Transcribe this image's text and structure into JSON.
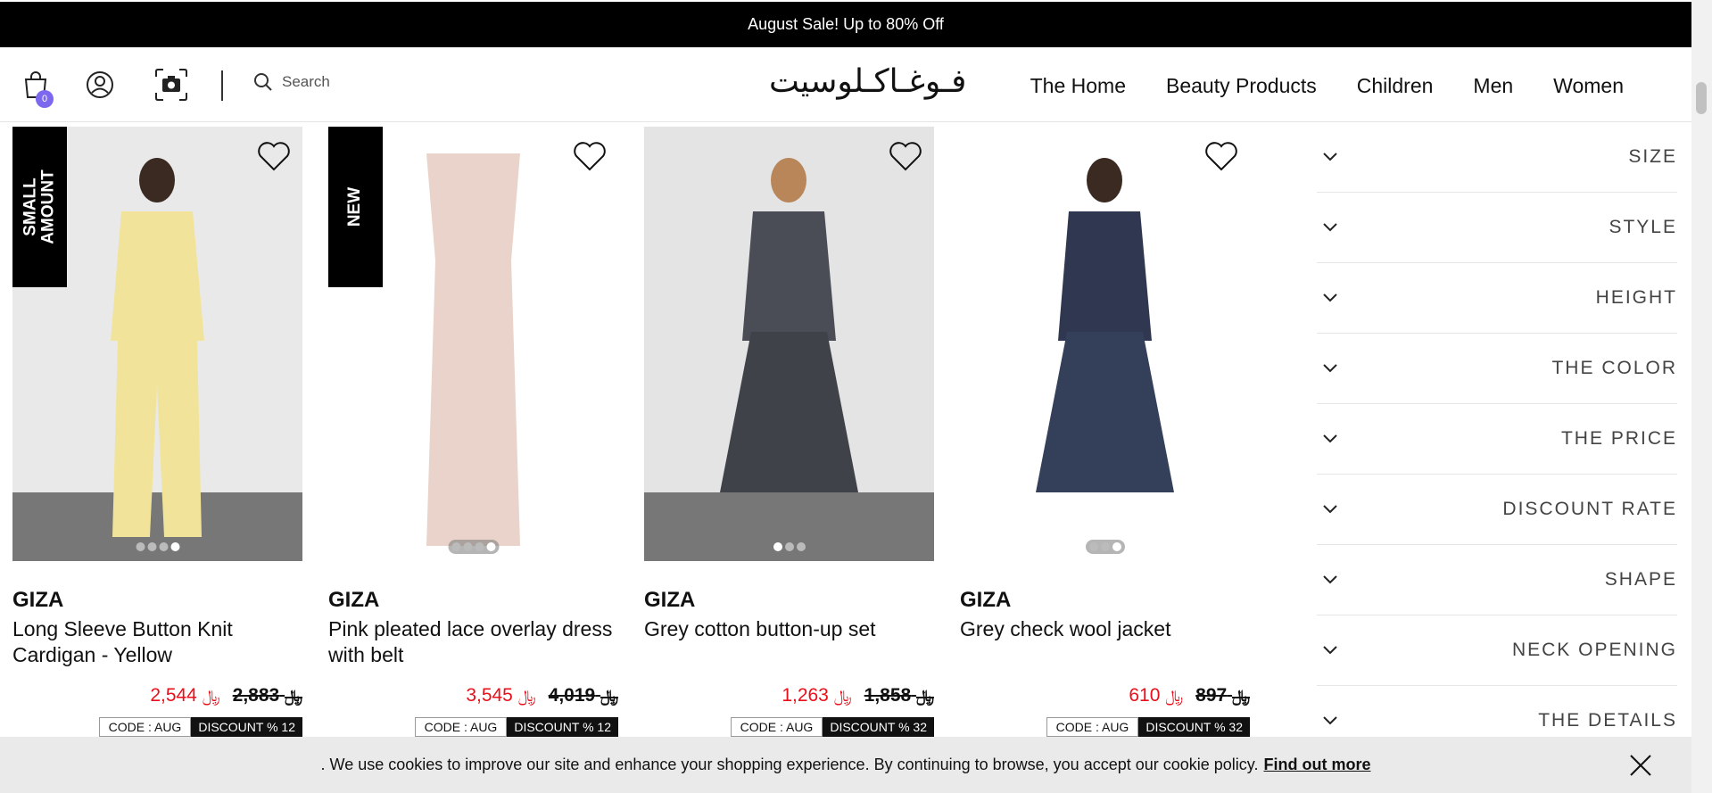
{
  "promo": {
    "text": "August Sale! Up to 80% Off"
  },
  "header": {
    "cart_count": "0",
    "search_placeholder": "Search",
    "logo_text": "فـوغـاكـلوسيت",
    "nav": [
      "The Home",
      "Beauty Products",
      "Children",
      "Men",
      "Women"
    ]
  },
  "products": [
    {
      "ribbon": "SMALL\nAMOUNT",
      "brand": "GIZA",
      "name": "Long Sleeve Button Knit Cardigan - Yellow",
      "price": "2,544",
      "old_price": "2,883",
      "code": "CODE : AUG",
      "discount": "DISCOUNT % 12",
      "image_dots": 4,
      "active_dot": 3,
      "bg": "#e9e9e9",
      "garment": "#f1e49a"
    },
    {
      "ribbon": "NEW",
      "brand": "GIZA",
      "name": "Pink pleated lace overlay dress with belt",
      "price": "3,545",
      "old_price": "4,019",
      "code": "CODE : AUG",
      "discount": "DISCOUNT % 12",
      "image_dots": 4,
      "active_dot": 3,
      "bg": "#ffffff",
      "garment": "#e9d3cb"
    },
    {
      "ribbon": "",
      "brand": "GIZA",
      "name": "Grey cotton button-up set",
      "price": "1,263",
      "old_price": "1,858",
      "code": "CODE : AUG",
      "discount": "DISCOUNT % 32",
      "image_dots": 3,
      "active_dot": 0,
      "bg": "#e4e4e4",
      "garment": "#4a4d55"
    },
    {
      "ribbon": "",
      "brand": "GIZA",
      "name": "Grey check wool jacket",
      "price": "610",
      "old_price": "897",
      "code": "CODE : AUG",
      "discount": "DISCOUNT % 32",
      "image_dots": 3,
      "active_dot": 2,
      "bg": "#ffffff",
      "garment": "#2f3850"
    }
  ],
  "currency_symbol": "﷼",
  "filters": [
    "SIZE",
    "STYLE",
    "HEIGHT",
    "THE COLOR",
    "THE PRICE",
    "DISCOUNT RATE",
    "SHAPE",
    "NECK OPENING",
    "THE DETAILS"
  ],
  "cookie": {
    "text": ". We use cookies to improve our site and enhance your shopping experience. By continuing to browse, you accept our cookie policy.",
    "link": "Find out more"
  },
  "colors": {
    "price_red": "#e8101a",
    "badge": "#7b68ee",
    "black": "#000000"
  }
}
